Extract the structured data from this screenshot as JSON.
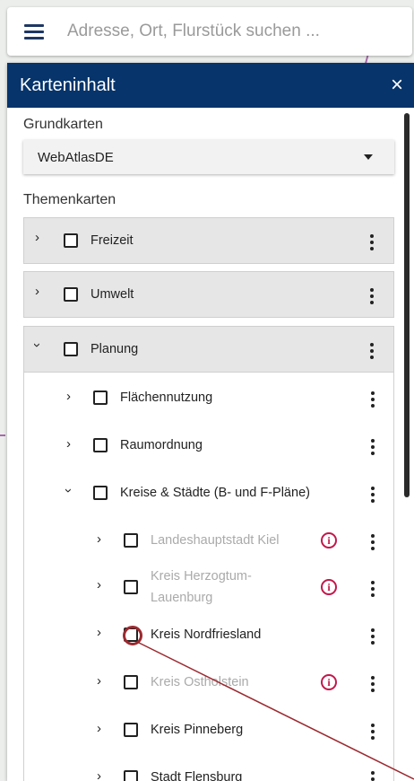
{
  "search": {
    "placeholder": "Adresse, Ort, Flurstück suchen ..."
  },
  "panel": {
    "title": "Karteninhalt",
    "close_label": "×",
    "grundkarten": {
      "label": "Grundkarten",
      "selected": "WebAtlasDE"
    },
    "themenkarten": {
      "label": "Themenkarten"
    }
  },
  "groups": [
    {
      "label": "Freizeit",
      "expanded": false
    },
    {
      "label": "Umwelt",
      "expanded": false
    },
    {
      "label": "Planung",
      "expanded": true
    }
  ],
  "planung_children": [
    {
      "label": "Flächennutzung",
      "expanded": false
    },
    {
      "label": "Raumordnung",
      "expanded": false
    },
    {
      "label": "Kreise & Städte (B- und F-Pläne)",
      "expanded": true
    }
  ],
  "kreise_children": [
    {
      "label": "Landeshauptstadt Kiel",
      "disabled": true,
      "info": true
    },
    {
      "label": "Kreis Herzogtum-Lauenburg",
      "disabled": true,
      "info": true
    },
    {
      "label": "Kreis Nordfriesland",
      "disabled": false,
      "info": false
    },
    {
      "label": "Kreis Ostholstein",
      "disabled": true,
      "info": true
    },
    {
      "label": "Kreis Pinneberg",
      "disabled": false,
      "info": false
    },
    {
      "label": "Stadt Flensburg",
      "disabled": false,
      "info": false
    }
  ],
  "colors": {
    "header_bg": "#06346b",
    "info_icon": "#c2184b",
    "highlight_ring": "#9b2a30"
  },
  "icons": {
    "menu": "hamburger-icon",
    "close": "close-icon",
    "expand": "chevron-right-icon",
    "collapse": "chevron-down-icon",
    "more": "more-vertical-icon",
    "info": "info-icon"
  }
}
